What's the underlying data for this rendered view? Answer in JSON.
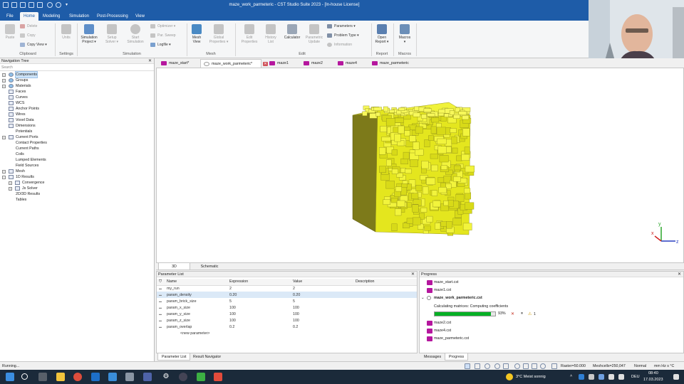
{
  "titlebar": {
    "title": "maze_work_parmeteric - CST Studio Suite 2023 - [In-house License]"
  },
  "menu_tabs": [
    {
      "label": "File"
    },
    {
      "label": "Home"
    },
    {
      "label": "Modeling"
    },
    {
      "label": "Simulation"
    },
    {
      "label": "Post-Processing"
    },
    {
      "label": "View"
    }
  ],
  "ribbon": {
    "paste": "Paste",
    "delete": "Delete",
    "copy": "Copy",
    "copy_view": "Copy View",
    "clipboard": "Clipboard",
    "units": "Units",
    "settings": "Settings",
    "simulation_project_1": "Simulation",
    "simulation_project_2": "Project",
    "setup_solver_1": "Setup",
    "setup_solver_2": "Solver",
    "start_simulation_1": "Start",
    "start_simulation_2": "Simulation",
    "optimizer": "Optimizer",
    "par_sweep": "Par. Sweep",
    "logfile": "Logfile",
    "simulation": "Simulation",
    "mesh_view_1": "Mesh",
    "mesh_view_2": "View",
    "global_properties_1": "Global",
    "global_properties_2": "Properties",
    "mesh": "Mesh",
    "edit_properties_1": "Edit",
    "edit_properties_2": "Properties",
    "history_list_1": "History",
    "history_list_2": "List",
    "calculator": "Calculator",
    "parametric_update_1": "Parametric",
    "parametric_update_2": "Update",
    "parameters": "Parameters",
    "problem_type": "Problem Type",
    "information": "Information",
    "edit": "Edit",
    "open_report_1": "Open",
    "open_report_2": "Report",
    "report": "Report",
    "macros": "Macros",
    "macros_group": "Macros"
  },
  "navtree": {
    "title": "Navigation Tree",
    "search_placeholder": "Search",
    "items": [
      {
        "label": "Components"
      },
      {
        "label": "Groups"
      },
      {
        "label": "Materials"
      },
      {
        "label": "Faces"
      },
      {
        "label": "Curves"
      },
      {
        "label": "WCS"
      },
      {
        "label": "Anchor Points"
      },
      {
        "label": "Wires"
      },
      {
        "label": "Voxel Data"
      },
      {
        "label": "Dimensions"
      },
      {
        "label": "Potentials"
      },
      {
        "label": "Current Ports"
      },
      {
        "label": "Contact Properties"
      },
      {
        "label": "Current Paths"
      },
      {
        "label": "Coils"
      },
      {
        "label": "Lumped Elements"
      },
      {
        "label": "Field Sources"
      },
      {
        "label": "Mesh"
      },
      {
        "label": "1D Results"
      },
      {
        "label": "Convergence"
      },
      {
        "label": "Js Solver"
      },
      {
        "label": "2D/3D Results"
      },
      {
        "label": "Tables"
      }
    ]
  },
  "doc_tabs": [
    {
      "label": "maze_start*"
    },
    {
      "label": "maze_work_parmeteric*"
    },
    {
      "label": "maze1"
    },
    {
      "label": "maze2"
    },
    {
      "label": "maze4"
    },
    {
      "label": "maze_parmeteric"
    }
  ],
  "axes": {
    "x": "x",
    "y": "y",
    "z": "z"
  },
  "view_tabs": [
    {
      "label": "3D"
    },
    {
      "label": "Schematic"
    }
  ],
  "param_list": {
    "title": "Parameter List",
    "columns": [
      "Name",
      "Expression",
      "Value",
      "Description"
    ],
    "rows": [
      {
        "name": "my_run",
        "expr": "2",
        "value": "2"
      },
      {
        "name": "param_density",
        "expr": "0.20",
        "value": "0.20"
      },
      {
        "name": "param_brick_size",
        "expr": "5",
        "value": "5"
      },
      {
        "name": "param_x_size",
        "expr": "100",
        "value": "100"
      },
      {
        "name": "param_y_size",
        "expr": "100",
        "value": "100"
      },
      {
        "name": "param_z_size",
        "expr": "100",
        "value": "100"
      },
      {
        "name": "param_overlap",
        "expr": "0.2",
        "value": "0.2"
      }
    ],
    "new_row": "<new parameter>",
    "tabs": [
      {
        "label": "Parameter List"
      },
      {
        "label": "Result Navigator"
      }
    ]
  },
  "progress": {
    "title": "Progress",
    "files_before": [
      {
        "label": "maze_start.cst"
      },
      {
        "label": "maze1.cst"
      }
    ],
    "active": "maze_work_parmeteric.cst",
    "status": "Calculating matrices: Computing coefficients",
    "percent_value": 0.93,
    "percent": "93%",
    "warnings": "1",
    "files_after": [
      {
        "label": "maze2.cst"
      },
      {
        "label": "maze4.cst"
      },
      {
        "label": "maze_parmeteric.cst"
      }
    ],
    "tabs": [
      {
        "label": "Messages"
      },
      {
        "label": "Progress"
      }
    ]
  },
  "statusbar": {
    "running": "Running...",
    "raster": "Raster=50.000",
    "meshcells": "Meshcells=250,047",
    "mode": "Normal",
    "units": "mm  Hz  s  °C"
  },
  "taskbar": {
    "weather": "3°C  Meist sonnig",
    "lang": "DEU",
    "time": "08:40",
    "date": "17.03.2023"
  },
  "colors": {
    "brand": "#1e5ca8",
    "model": "#e4e61e",
    "progress": "#06b025"
  }
}
